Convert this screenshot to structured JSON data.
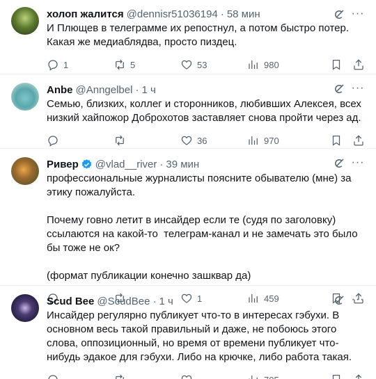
{
  "tweets": [
    {
      "name": "холоп жалится",
      "handle": "@dennisr51036194",
      "time": "58 мин",
      "text": "И Плющев в телеграмме их репостнул, а потом быстро потер. Какая же медиаблядва, просто пиздец.",
      "replies": "1",
      "reposts": "5",
      "likes": "53",
      "views": "980",
      "verified": false
    },
    {
      "name": "Anbe",
      "handle": "@Anngelbel",
      "time": "1 ч",
      "text": "Семью, близких, коллег и сторонников, любивших Алексея, всех низкий хайпожор Доброхотов заставляет снова пройти через ад.",
      "replies": "",
      "reposts": "",
      "likes": "36",
      "views": "970",
      "verified": false
    },
    {
      "name": "Ривер",
      "handle": "@vlad__river",
      "time": "39 мин",
      "text": "профессиональные журналисты поясните обывателю (мне) за этику пожалуйста.\n\nПочему говно летит в инсайдер если те (судя по заголовку) ссылаются на какой-то  телеграм-канал и не замечать это было бы тоже не ок?\n\n(формат публикации конечно зашквар да)",
      "replies": "",
      "reposts": "",
      "likes": "1",
      "views": "459",
      "verified": true
    },
    {
      "name": "Scud Bee",
      "handle": "@ScudBee",
      "time": "1 ч",
      "text": "Инсайдер регулярно публикует что-то в интересах гэбухи. В основном весь такой правильный и даже, не побоюсь этого слова, оппозиционный, но время от времени публикует что-нибудь эдакое для гэбухи. Либо на крючке, либо работа такая.",
      "replies": "",
      "reposts": "",
      "likes": "",
      "views": "705",
      "verified": false
    }
  ],
  "separator": "·",
  "icons": {
    "reply": "reply-icon",
    "repost": "repost-icon",
    "like": "heart-icon",
    "views": "views-icon",
    "bookmark": "bookmark-icon",
    "share": "share-icon",
    "grok": "grok-icon",
    "more": "more-icon"
  },
  "colors": {
    "text": "#0f1419",
    "secondary": "#536471",
    "verified": "#1d9bf0",
    "divider": "#eff3f4"
  }
}
